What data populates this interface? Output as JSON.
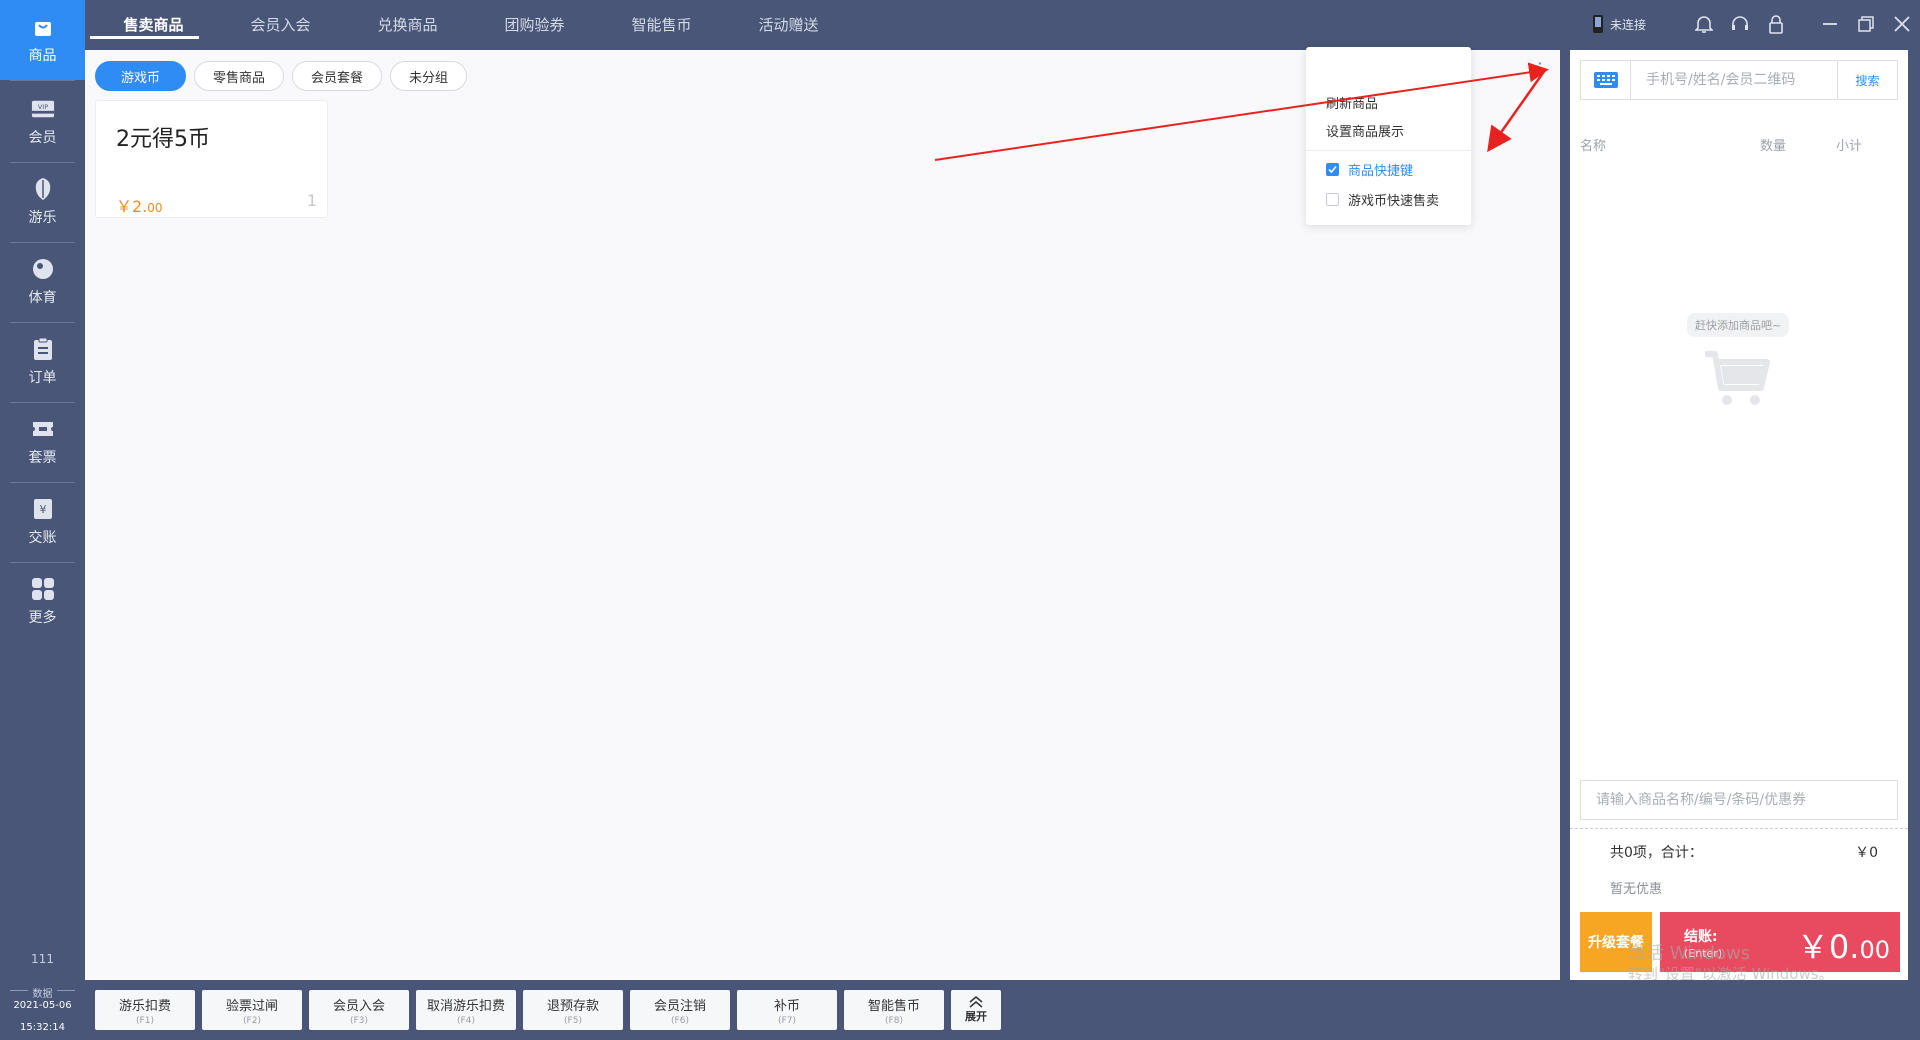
{
  "sidebar": {
    "items": [
      {
        "label": "商品",
        "icon": "bag-icon"
      },
      {
        "label": "会员",
        "icon": "vip-card-icon"
      },
      {
        "label": "游乐",
        "icon": "shield-icon"
      },
      {
        "label": "体育",
        "icon": "ball-icon"
      },
      {
        "label": "订单",
        "icon": "clipboard-icon"
      },
      {
        "label": "套票",
        "icon": "ticket-icon"
      },
      {
        "label": "交账",
        "icon": "yuan-icon"
      },
      {
        "label": "更多",
        "icon": "grid-icon"
      }
    ],
    "user_number": "111",
    "date_label": "数据",
    "date": "2021-05-06",
    "time": "15:32:14"
  },
  "top_tabs": [
    "售卖商品",
    "会员入会",
    "兑换商品",
    "团购验券",
    "智能售币",
    "活动赠送"
  ],
  "top_right": {
    "connection_status": "未连接"
  },
  "sub_tabs": [
    "游戏币",
    "零售商品",
    "会员套餐",
    "未分组"
  ],
  "product": {
    "title": "2元得5币",
    "price_int": "￥2.",
    "price_dec": "00",
    "count": "1"
  },
  "menu": {
    "refresh": "刷新商品",
    "settings": "设置商品展示",
    "shortcut": "商品快捷键",
    "quick_sell": "游戏币快速售卖"
  },
  "cart": {
    "search_placeholder": "手机号/姓名/会员二维码",
    "search_button": "搜索",
    "col_name": "名称",
    "col_qty": "数量",
    "col_subtotal": "小计",
    "empty_hint": "赶快添加商品吧~",
    "product_input_placeholder": "请输入商品名称/编号/条码/优惠券",
    "summary": "共0项，合计：",
    "total": "￥0",
    "discount": "暂无优惠",
    "upgrade": "升级套餐",
    "checkout_label": "结账:",
    "checkout_key": "(Enter)",
    "amount_int": "￥0.",
    "amount_dec": "00"
  },
  "bottom_buttons": [
    {
      "label": "游乐扣费",
      "key": "(F1)"
    },
    {
      "label": "验票过闸",
      "key": "(F2)"
    },
    {
      "label": "会员入会",
      "key": "(F3)"
    },
    {
      "label": "取消游乐扣费",
      "key": "(F4)"
    },
    {
      "label": "退预存款",
      "key": "(F5)"
    },
    {
      "label": "会员注销",
      "key": "(F6)"
    },
    {
      "label": "补币",
      "key": "(F7)"
    },
    {
      "label": "智能售币",
      "key": "(F8)"
    }
  ],
  "expand_label": "展开",
  "watermark": {
    "line1": "激活 Windows",
    "line2": "转到\"设置\"以激活 Windows。"
  },
  "colors": {
    "sidebar": "#4a5677",
    "accent": "#2f8cf5",
    "price": "#f08c18",
    "checkout": "#e84a5f",
    "upgrade": "#f6a623",
    "annotation": "#e8231f"
  }
}
